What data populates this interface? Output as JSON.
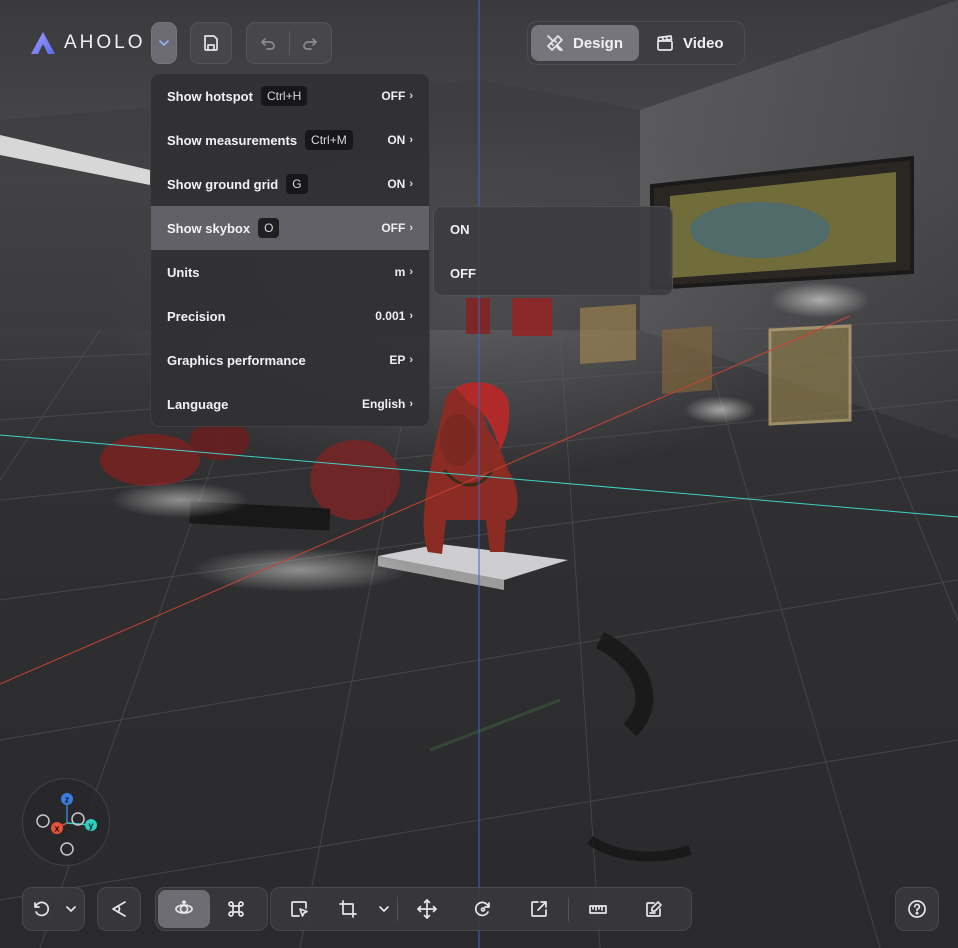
{
  "app": {
    "logo_text": "AHOLO"
  },
  "topbar": {
    "modes": [
      {
        "label": "Design",
        "icon": "pencil-ruler-icon",
        "active": true
      },
      {
        "label": "Video",
        "icon": "clapperboard-icon",
        "active": false
      }
    ]
  },
  "settings_menu": {
    "items": [
      {
        "label": "Show hotspot",
        "shortcut": "Ctrl+H",
        "value": "OFF"
      },
      {
        "label": "Show measurements",
        "shortcut": "Ctrl+M",
        "value": "ON"
      },
      {
        "label": "Show ground grid",
        "shortcut": "G",
        "value": "ON"
      },
      {
        "label": "Show skybox",
        "shortcut": "O",
        "value": "OFF",
        "highlighted": true
      },
      {
        "label": "Units",
        "shortcut": "",
        "value": "m"
      },
      {
        "label": "Precision",
        "shortcut": "",
        "value": "0.001"
      },
      {
        "label": "Graphics performance",
        "shortcut": "",
        "value": "EP"
      },
      {
        "label": "Language",
        "shortcut": "",
        "value": "English"
      }
    ],
    "chevron": "›"
  },
  "skybox_submenu": {
    "options": [
      "ON",
      "OFF"
    ]
  },
  "gizmo": {
    "axes": {
      "z": "z",
      "x": "x",
      "y": "y"
    },
    "colors": {
      "z": "#3b7ddd",
      "x": "#e5533b",
      "y": "#2fcfc4"
    }
  },
  "colors": {
    "accent_logo": "#7b7cf5",
    "axis_red": "#c8432f",
    "axis_cyan": "#3fd0c6",
    "axis_blue": "#3d64c8"
  }
}
